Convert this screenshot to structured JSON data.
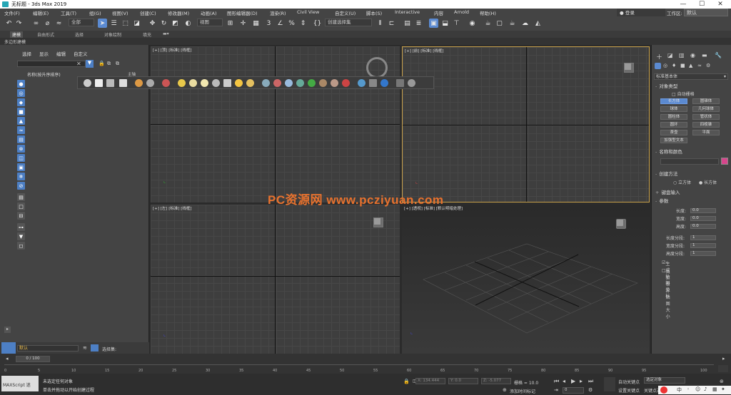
{
  "window": {
    "title": "无标题 - 3ds Max 2019",
    "minimize": "—",
    "maximize": "☐",
    "close": "✕"
  },
  "menu": [
    "文件(F)",
    "编辑(E)",
    "工具(T)",
    "组(G)",
    "视图(V)",
    "创建(C)",
    "修改器(M)",
    "动画(A)",
    "图形编辑器(D)",
    "渲染(R)",
    "Civil View",
    "自定义(U)",
    "脚本(S)",
    "Interactive",
    "内容",
    "Arnold",
    "帮助(H)"
  ],
  "account": {
    "login": "登录",
    "workspace_label": "工作区:",
    "workspace_value": "默认"
  },
  "toolbar": {
    "filter": "全部",
    "refcoord": "视图",
    "selset": "创建选择集"
  },
  "ribbon": {
    "tabs": [
      "建模",
      "自由形式",
      "选择",
      "对象绘制",
      "填充"
    ],
    "sub": "多边形建模"
  },
  "scene_explorer": {
    "menus": [
      "选择",
      "显示",
      "编辑",
      "自定义"
    ],
    "column": "名称(按升序排序)"
  },
  "float_toolbar": {
    "label": "主轴"
  },
  "viewports": {
    "top": "[+] [顶] [标准] [线框]",
    "front": "[+] [前] [标准] [线框]",
    "left": "[+] [左] [标准] [线框]",
    "persp": "[+] [透视] [标准] [默认明暗处理]"
  },
  "watermark": "PC资源网 www.pcziyuan.com",
  "command_panel": {
    "category": "标准基本体",
    "object_type": "对象类型",
    "autogrid": "自动栅格",
    "objects": [
      "长方体",
      "圆锥体",
      "球体",
      "几何球体",
      "圆柱体",
      "管状体",
      "圆环",
      "四棱锥",
      "茶壶",
      "平面",
      "加强型文本"
    ],
    "name_color": "名称和颜色",
    "creation_method": "创建方法",
    "methods": [
      "立方体",
      "长方体"
    ],
    "keyboard": "键盘输入",
    "params": "参数",
    "length": "长度:",
    "width": "宽度:",
    "height": "高度:",
    "length_v": "0.0",
    "width_v": "0.0",
    "height_v": "0.0",
    "lseg": "长度分段:",
    "wseg": "宽度分段:",
    "hseg": "高度分段:",
    "lseg_v": "1",
    "wseg_v": "1",
    "hseg_v": "1",
    "gen_uv": "生成贴图坐标",
    "real_world": "真实世界贴图大小"
  },
  "layer": {
    "name": "默认",
    "selset": "选择集:"
  },
  "timeline": {
    "frame": "0 / 100",
    "ticks": [
      "0",
      "5",
      "10",
      "15",
      "20",
      "25",
      "30",
      "35",
      "40",
      "45",
      "50",
      "55",
      "60",
      "65",
      "70",
      "75",
      "80",
      "85",
      "90",
      "95",
      "100"
    ]
  },
  "status": {
    "maxscript": "MAXScript 迷",
    "line1": "未选定任何对象",
    "line2": "单击并拖动以开始创建过程",
    "x": "X: 134.444",
    "y": "Y: 0.0",
    "z": "Z: -5.077",
    "grid": "栅格 = 10.0",
    "addtime": "添加时间标记",
    "autokey": "自动关键点",
    "setkey": "设置关键点",
    "selobj": "选定对象",
    "keyfilter": "关键点过滤器...",
    "frame": "0"
  }
}
